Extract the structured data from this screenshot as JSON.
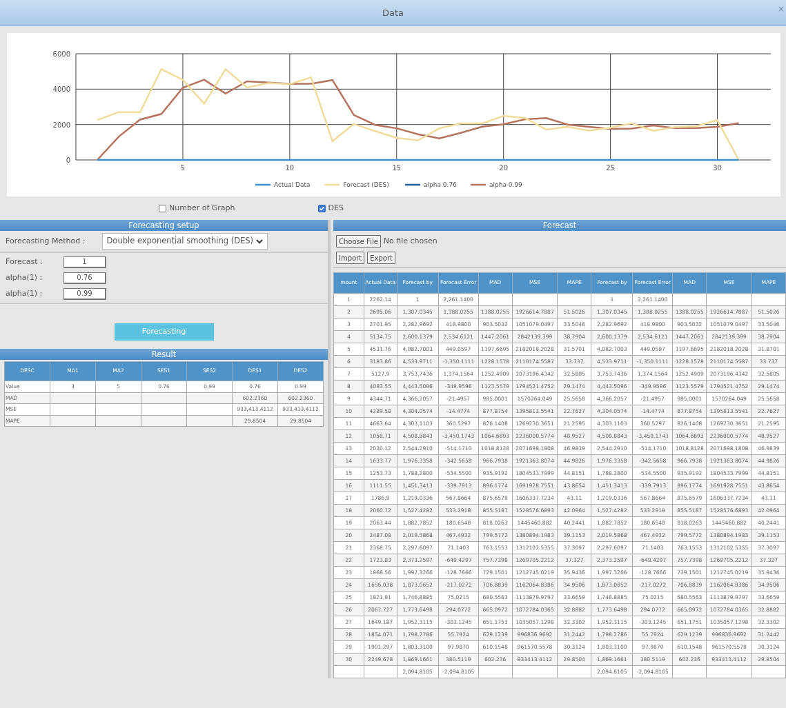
{
  "window": {
    "title": "Data",
    "close": "×"
  },
  "chart": {
    "chart_data": {
      "type": "line",
      "x": [
        1,
        2,
        3,
        4,
        5,
        6,
        7,
        8,
        9,
        10,
        11,
        12,
        13,
        14,
        15,
        16,
        17,
        18,
        19,
        20,
        21,
        22,
        23,
        24,
        25,
        26,
        27,
        28,
        29,
        30,
        31
      ],
      "xlim": [
        0,
        32.5
      ],
      "ylim": [
        0,
        6000
      ],
      "xticks": [
        {
          "value": 5,
          "label": "5"
        },
        {
          "value": 10,
          "label": "10"
        },
        {
          "value": 15,
          "label": "15"
        },
        {
          "value": 20,
          "label": "20"
        },
        {
          "value": 25,
          "label": "25"
        },
        {
          "value": 30,
          "label": "30"
        }
      ],
      "yticks": [
        {
          "value": 0,
          "label": "0"
        },
        {
          "value": 2000,
          "label": "2000"
        },
        {
          "value": 4000,
          "label": "4000"
        },
        {
          "value": 6000,
          "label": "6000"
        }
      ],
      "grid": true,
      "legend": true,
      "series": [
        {
          "name": "Actual Data",
          "color": "#3a8fd3",
          "values": [
            0,
            0,
            0,
            0,
            0,
            0,
            0,
            0,
            0,
            0,
            0,
            0,
            0,
            0,
            0,
            0,
            0,
            0,
            0,
            0,
            0,
            0,
            0,
            0,
            0,
            0,
            0,
            0,
            0,
            0,
            0
          ]
        },
        {
          "name": "Forecast (DES)",
          "color": "#f0dc9a",
          "values": [
            2260,
            2700,
            2700,
            5130,
            4530,
            3180,
            5130,
            4090,
            4340,
            4290,
            4660,
            1060,
            2030,
            1630,
            1250,
            1110,
            1790,
            2060,
            2060,
            2490,
            2370,
            1720,
            1870,
            1660,
            1820,
            2070,
            1650,
            1850,
            1900,
            2250,
            0
          ]
        },
        {
          "name": "alpha 0.76",
          "color": "#1f5f9e",
          "values": [
            null,
            null,
            null,
            null,
            null,
            null,
            null,
            null,
            null,
            null,
            null,
            null,
            null,
            null,
            null,
            null,
            null,
            null,
            null,
            null,
            null,
            null,
            null,
            null,
            null,
            null,
            null,
            null,
            null,
            null,
            null
          ]
        },
        {
          "name": "alpha 0.99",
          "color": "#b5735e",
          "values": [
            0,
            1310,
            2280,
            2600,
            4080,
            4530,
            3750,
            4440,
            4370,
            4300,
            4300,
            4510,
            2540,
            1980,
            1790,
            1450,
            1220,
            1530,
            1880,
            2020,
            2300,
            2370,
            2000,
            1870,
            1750,
            1770,
            1950,
            1800,
            1800,
            1870,
            2090
          ]
        }
      ]
    }
  },
  "options": [
    {
      "label": "Number of Graph",
      "checked": false
    },
    {
      "label": "DES",
      "checked": true
    }
  ],
  "setup": {
    "title": "Forecasting setup",
    "method_label": "Forecasting Method :",
    "method_value": "Double exponential smoothing (DES)",
    "fields": [
      {
        "label": "Forecast :",
        "value": "1"
      },
      {
        "label": "alpha(1) :",
        "value": "0.76"
      },
      {
        "label": "alpha(1) :",
        "value": "0.99"
      }
    ],
    "button": "Forecasting"
  },
  "result": {
    "title": "Result",
    "columns": [
      "DESC",
      "MA1",
      "MA2",
      "SES1",
      "SES2",
      "DES1",
      "DES2"
    ],
    "rows": [
      [
        "Value",
        "3",
        "5",
        "0.76",
        "0.99",
        "0.76",
        "0.99"
      ],
      [
        "MAD",
        null,
        null,
        null,
        null,
        "602.2360",
        "602.2360"
      ],
      [
        "MSE",
        null,
        null,
        null,
        null,
        "933,413.4112",
        "933,413.4112"
      ],
      [
        "MAPE",
        null,
        null,
        null,
        null,
        "29.8504",
        "29.8504"
      ]
    ]
  },
  "forecast": {
    "title": "Forecast",
    "choose_file": "Choose File",
    "file_status": "No file chosen",
    "import": "Import",
    "export": "Export",
    "columns": [
      "mount",
      "Actual Data",
      "Forecast by",
      "Forecast Error",
      "MAD",
      "MSE",
      "MAPE",
      "Forecast by",
      "Forecast Error",
      "MAD",
      "MSE",
      "MAPE"
    ],
    "rows": [
      [
        "1",
        "2262.14",
        "1",
        "2,261.1400",
        null,
        null,
        null,
        "1",
        "2,261.1400",
        null,
        null,
        null
      ],
      [
        "2",
        "2695.06",
        "1,307.0345",
        "1,388.0255",
        "1388.0255",
        "1926614.7887",
        "51.5026",
        "1,307.0345",
        "1,388.0255",
        "1388.0255",
        "1926614.7887",
        "51.5026"
      ],
      [
        "3",
        "2701.95",
        "2,282.9692",
        "418.9800",
        "903.5032",
        "1051079.0497",
        "33.5046",
        "2,282.9692",
        "418.9800",
        "903.5032",
        "1051079.0497",
        "33.5046"
      ],
      [
        "4",
        "5134.75",
        "2,600.1379",
        "2,534.6121",
        "1447.2061",
        "2842139.399",
        "38.7904",
        "2,600.1379",
        "2,534.6121",
        "1447.2061",
        "2842139.399",
        "38.7904"
      ],
      [
        "5",
        "4531.76",
        "4,082.7003",
        "449.0597",
        "1197.6695",
        "2182018.2028",
        "31.5701",
        "4,082.7003",
        "449.0597",
        "1197.6695",
        "2182018.2028",
        "31.8701"
      ],
      [
        "6",
        "3183.86",
        "4,533.9711",
        "-1,350.1111",
        "1228.1578",
        "2110174.5587",
        "33.737",
        "4,533.9711",
        "-1,350.1111",
        "1228.1578",
        "2110174.5587",
        "33.737"
      ],
      [
        "7",
        "5127.9",
        "3,753.7436",
        "1,374.1564",
        "1252.4909",
        "2073196.4342",
        "32.5805",
        "3,753.7436",
        "1,374.1564",
        "1252.4909",
        "2073196.4342",
        "32.5805"
      ],
      [
        "8",
        "4093.55",
        "4,443.5096",
        "-349.9596",
        "1123.5579",
        "1794521.4752",
        "29.1474",
        "4,443.5096",
        "-349.9596",
        "1123.5579",
        "1794521.4752",
        "29.1474"
      ],
      [
        "9",
        "4344.71",
        "4,366.2057",
        "-21.4957",
        "985.0001",
        "1570264.049",
        "25.5658",
        "4,366.2057",
        "-21.4957",
        "985.0001",
        "1570264.049",
        "25.5658"
      ],
      [
        "10",
        "4289.58",
        "4,304.0574",
        "-14.4774",
        "877.8754",
        "1395813.5541",
        "22.7627",
        "4,304.0574",
        "-14.4774",
        "877.8754",
        "1395813.5541",
        "22.7627"
      ],
      [
        "11",
        "4663.64",
        "4,303.1103",
        "360.5297",
        "826.1408",
        "1269230.3651",
        "21.2595",
        "4,303.1103",
        "360.5297",
        "826.1408",
        "1269230.3651",
        "21.2595"
      ],
      [
        "12",
        "1058.71",
        "4,508.8843",
        "-3,450.1743",
        "1064.6893",
        "2236000.5774",
        "48.9527",
        "4,508.8843",
        "-3,450.1743",
        "1064.6893",
        "2236000.5774",
        "48.9527"
      ],
      [
        "13",
        "2030.12",
        "2,544.2910",
        "-514.1710",
        "1018.8128",
        "2071698.1808",
        "46.9839",
        "2,544.2910",
        "-514.1710",
        "1018.8128",
        "2071698.1808",
        "46.9839"
      ],
      [
        "14",
        "1633.77",
        "1,976.3358",
        "-342.5658",
        "966.7938",
        "1921363.8074",
        "44.9826",
        "1,976.3358",
        "-342.5658",
        "966.7938",
        "1921363.8074",
        "44.9826"
      ],
      [
        "15",
        "1253.73",
        "1,788.2800",
        "-534.5500",
        "935.9192",
        "1804533.7999",
        "44.8151",
        "1,788.2800",
        "-534.5500",
        "935.9192",
        "1804533.7999",
        "44.8151"
      ],
      [
        "16",
        "1111.55",
        "1,451.3413",
        "-339.7913",
        "896.1774",
        "1691928.7551",
        "43.8654",
        "1,451.3413",
        "-339.7913",
        "896.1774",
        "1691928.7551",
        "43.8654"
      ],
      [
        "17",
        "1786.9",
        "1,219.0336",
        "567.8664",
        "875.6579",
        "1606337.7234",
        "43.11",
        "1,219.0336",
        "567.8664",
        "875.6579",
        "1606337.7234",
        "43.11"
      ],
      [
        "18",
        "2060.72",
        "1,527.4282",
        "533.2918",
        "855.5187",
        "1528576.6893",
        "42.0964",
        "1,527.4282",
        "533.2918",
        "855.5187",
        "1528576.6893",
        "42.0964"
      ],
      [
        "19",
        "2063.44",
        "1,882.7852",
        "180.6548",
        "818.0263",
        "1445460.882",
        "40.2441",
        "1,882.7852",
        "180.6548",
        "818.0263",
        "1445460.882",
        "40.2441"
      ],
      [
        "20",
        "2487.08",
        "2,019.5868",
        "467.4932",
        "799.5772",
        "1380894.1983",
        "39.1153",
        "2,019.5868",
        "467.4932",
        "799.5772",
        "1380894.1983",
        "39.1153"
      ],
      [
        "21",
        "2368.75",
        "2,297.6097",
        "71.1403",
        "763.1553",
        "1312102.5355",
        "37.3097",
        "2,297.6097",
        "71.1403",
        "763.1553",
        "1312102.5355",
        "37.3097"
      ],
      [
        "22",
        "1723.83",
        "2,373.2597",
        "-649.4297",
        "757.7398",
        "1269705.2212",
        "37.327",
        "2,373.2597",
        "-649.4297",
        "757.7398",
        "1269705.2212",
        "37.327"
      ],
      [
        "23",
        "1868.56",
        "1,997.3266",
        "-128.7666",
        "729.1501",
        "1212745.0219",
        "35.9436",
        "1,997.3266",
        "-128.7666",
        "729.1501",
        "1212745.0219",
        "35.9436"
      ],
      [
        "24",
        "1656.038",
        "1,873.0652",
        "-217.0272",
        "706.8839",
        "1162064.8386",
        "34.9506",
        "1,873.0652",
        "-217.0272",
        "706.8839",
        "1162064.8386",
        "34.9506"
      ],
      [
        "25",
        "1821.91",
        "1,746.8885",
        "75.0215",
        "680.5563",
        "1113879.9797",
        "33.6659",
        "1,746.8885",
        "75.0215",
        "680.5563",
        "1113879.9797",
        "33.6659"
      ],
      [
        "26",
        "2067.727",
        "1,773.6498",
        "294.0772",
        "665.0972",
        "1072784.0365",
        "32.8882",
        "1,773.6498",
        "294.0772",
        "665.0972",
        "1072784.0365",
        "32.8882"
      ],
      [
        "27",
        "1649.187",
        "1,952.3115",
        "-303.1245",
        "651.1751",
        "1035057.1298",
        "32.3302",
        "1,952.3115",
        "-303.1245",
        "651.1751",
        "1035057.1298",
        "32.3302"
      ],
      [
        "28",
        "1854.071",
        "1,798.2786",
        "55.7924",
        "629.1239",
        "996836.9692",
        "31.2442",
        "1,798.2786",
        "55.7924",
        "629.1239",
        "996836.9692",
        "31.2442"
      ],
      [
        "29",
        "1901.297",
        "1,803.3100",
        "97.9870",
        "610.1548",
        "961570.5578",
        "30.3124",
        "1,803.3100",
        "97.9870",
        "610.1548",
        "961570.5578",
        "30.3124"
      ],
      [
        "30",
        "2249.678",
        "1,869.1661",
        "380.5119",
        "602.236",
        "933413.4112",
        "29.8504",
        "1,869.1661",
        "380.5119",
        "602.236",
        "933413.4112",
        "29.8504"
      ],
      [
        null,
        null,
        "2,094.8105",
        "-2,094.8105",
        null,
        null,
        null,
        "2,094.8105",
        "-2,094.8105",
        null,
        null,
        null
      ]
    ]
  }
}
